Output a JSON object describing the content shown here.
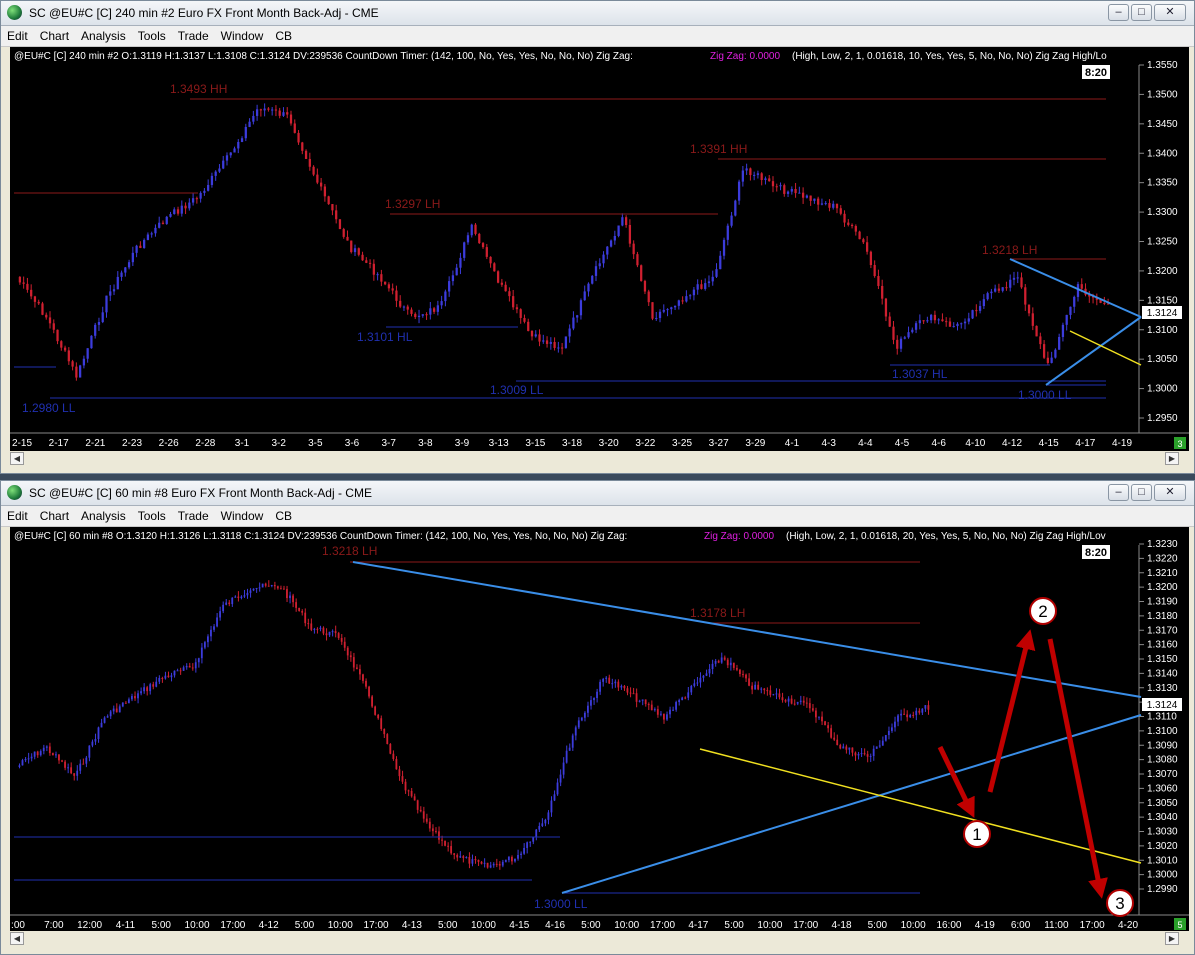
{
  "colors": {
    "up": "#3c3cdc",
    "down": "#d02030",
    "hh": "#8b1a1a",
    "ll": "#2030b0",
    "blue_line": "#3a8ee8",
    "yellow_line": "#f0e020",
    "arrow": "#c00000"
  },
  "windows": [
    {
      "title": "SC @EU#C [C]  240 min  #2  Euro FX Front Month Back-Adj - CME",
      "menu": [
        "Edit",
        "Chart",
        "Analysis",
        "Tools",
        "Trade",
        "Window",
        "CB"
      ],
      "info_left": "@EU#C [C]  240 min   #2 O:1.3119 H:1.3137 L:1.3108 C:1.3124 DV:239536  CountDown Timer:   (142, 100, No, Yes, Yes, No, No, No)  Zig Zag:",
      "info_zig": "Zig Zag: 0.0000",
      "info_right": "(High, Low, 2, 1, 0.01618, 10, Yes, Yes, 5, No, No, No)  Zig Zag High/Lo",
      "timer": "8:20",
      "price_labels": [
        "1.3550",
        "1.3500",
        "1.3450",
        "1.3400",
        "1.3350",
        "1.3300",
        "1.3250",
        "1.3200",
        "1.3150",
        "1.3100",
        "1.3050",
        "1.3000",
        "1.2950"
      ],
      "current_price": "1.3124",
      "date_labels": [
        "2-15",
        "2-17",
        "2-21",
        "2-23",
        "2-26",
        "2-28",
        "3-1",
        "3-2",
        "3-5",
        "3-6",
        "3-7",
        "3-8",
        "3-9",
        "3-13",
        "3-15",
        "3-18",
        "3-20",
        "3-22",
        "3-25",
        "3-27",
        "3-29",
        "4-1",
        "4-3",
        "4-4",
        "4-5",
        "4-6",
        "4-10",
        "4-12",
        "4-15",
        "4-17",
        "4-19"
      ],
      "annotations": [
        "1.3493 HH",
        "1.3391 HH",
        "1.3297 LH",
        "1.3218 LH",
        "1.3101 HL",
        "1.3009 LL",
        "1.3037 HL",
        "1.3000 LL",
        "1.2980 LL"
      ],
      "corner_badge": "3"
    },
    {
      "title": "SC @EU#C [C]  60 min  #8  Euro FX Front Month Back-Adj - CME",
      "menu": [
        "Edit",
        "Chart",
        "Analysis",
        "Tools",
        "Trade",
        "Window",
        "CB"
      ],
      "info_left": "@EU#C [C]  60 min   #8 O:1.3120 H:1.3126 L:1.3118 C:1.3124 DV:239536  CountDown Timer:   (142, 100, No, Yes, Yes, No, No, No)  Zig Zag:",
      "info_zig": "Zig Zag: 0.0000",
      "info_right": "(High, Low, 2, 1, 0.01618, 20, Yes, Yes, 5, No, No, No)  Zig Zag High/Lov",
      "timer": "8:20",
      "price_labels": [
        "1.3230",
        "1.3220",
        "1.3210",
        "1.3200",
        "1.3190",
        "1.3180",
        "1.3170",
        "1.3160",
        "1.3150",
        "1.3140",
        "1.3130",
        "1.3120",
        "1.3110",
        "1.3100",
        "1.3090",
        "1.3080",
        "1.3070",
        "1.3060",
        "1.3050",
        "1.3040",
        "1.3030",
        "1.3020",
        "1.3010",
        "1.3000",
        "1.2990"
      ],
      "current_price": "1.3124",
      "time_labels": [
        ":00",
        "7:00",
        "12:00",
        "4-11",
        "5:00",
        "10:00",
        "17:00",
        "4-12",
        "5:00",
        "10:00",
        "17:00",
        "4-13",
        "5:00",
        "10:00",
        "4-15",
        "4-16",
        "5:00",
        "10:00",
        "17:00",
        "4-17",
        "5:00",
        "10:00",
        "17:00",
        "4-18",
        "5:00",
        "10:00",
        "16:00",
        "4-19",
        "6:00",
        "11:00",
        "17:00",
        "4-20"
      ],
      "annotations": [
        "1.3218 LH",
        "1.3178 LH",
        "1.3000 LL"
      ],
      "markers": [
        "1",
        "2",
        "3"
      ],
      "corner_badge": "5"
    }
  ],
  "chart_data": [
    {
      "type": "candlestick",
      "title": "",
      "timeframe": "240 min",
      "ylim": [
        1.2925,
        1.3575
      ],
      "swing_points": [
        {
          "label": "1.3493 HH",
          "price": 1.3493
        },
        {
          "label": "1.3391 HH",
          "price": 1.3391
        },
        {
          "label": "1.3297 LH",
          "price": 1.3297
        },
        {
          "label": "1.3218 LH",
          "price": 1.3218
        },
        {
          "label": "1.3101 HL",
          "price": 1.3101
        },
        {
          "label": "1.3009 LL",
          "price": 1.3009
        },
        {
          "label": "1.3037 HL",
          "price": 1.3037
        },
        {
          "label": "1.3000 LL",
          "price": 1.3
        },
        {
          "label": "1.2980 LL",
          "price": 1.298
        }
      ],
      "last_close": 1.3124
    },
    {
      "type": "candlestick",
      "title": "",
      "timeframe": "60 min",
      "ylim": [
        1.2983,
        1.3238
      ],
      "swing_points": [
        {
          "label": "1.3218 LH",
          "price": 1.3218
        },
        {
          "label": "1.3178 LH",
          "price": 1.3178
        },
        {
          "label": "1.3000 LL",
          "price": 1.3
        }
      ],
      "last_close": 1.3124
    }
  ]
}
